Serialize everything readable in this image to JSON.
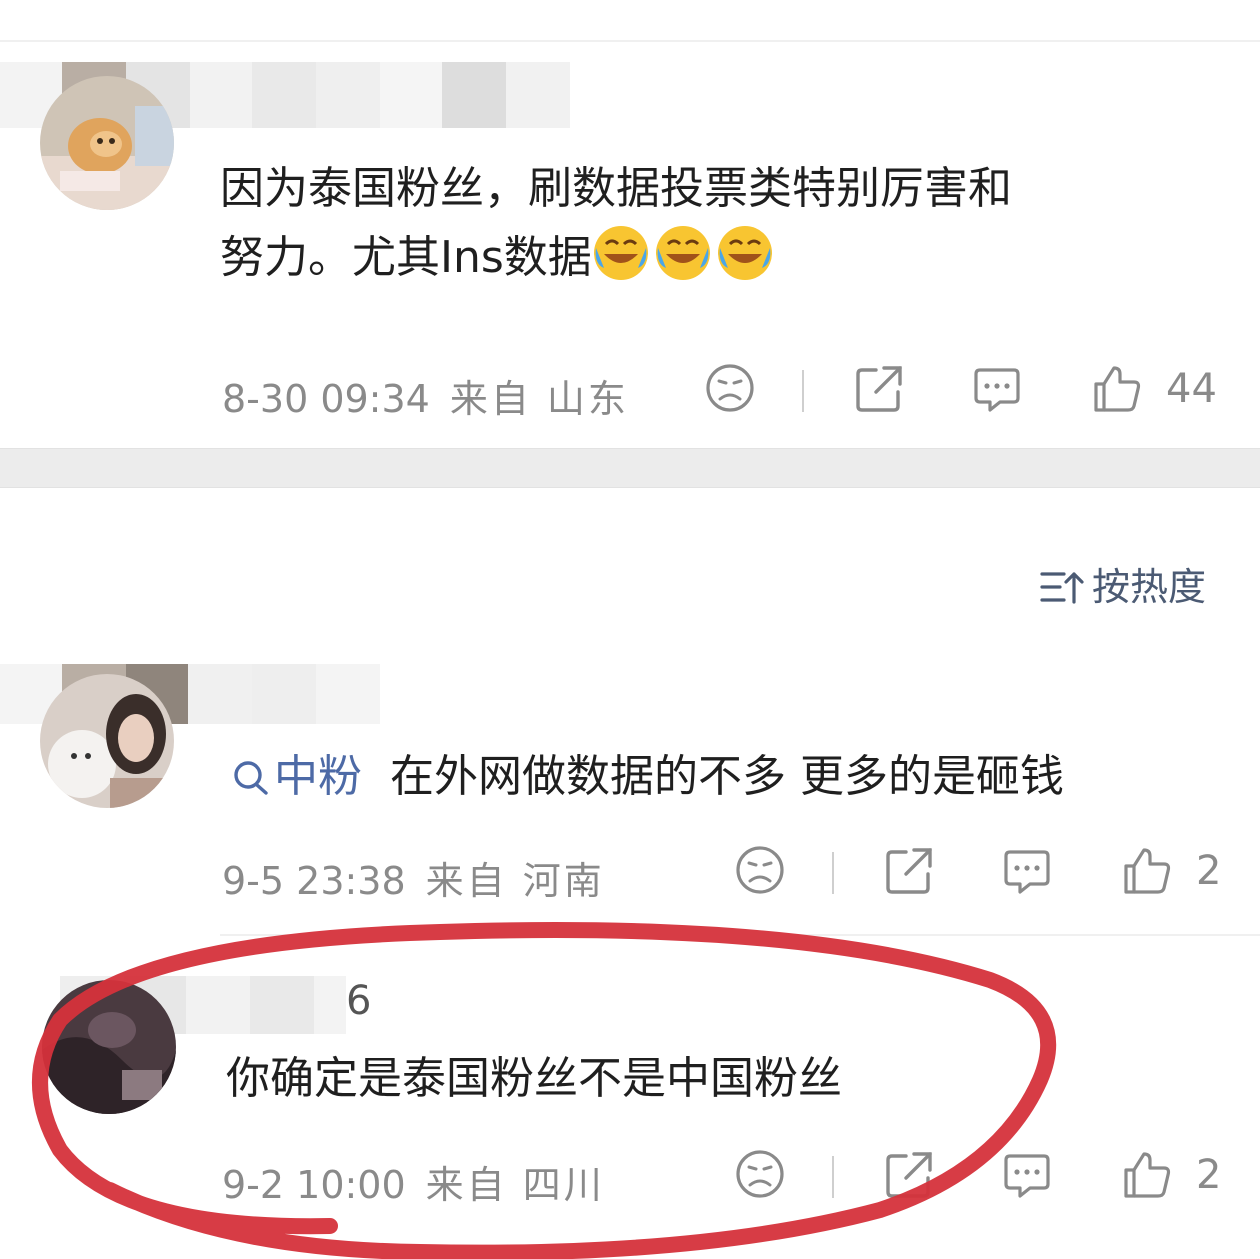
{
  "comments": [
    {
      "content_line1": "因为泰国粉丝，刷数据投票类特别厉害和",
      "content_line2": "努力。尤其Ins数据",
      "time": "8-30 09:34",
      "source": "来自 山东",
      "likes": "44"
    },
    {
      "fan_label": "中粉",
      "content": "在外网做数据的不多 更多的是砸钱",
      "time": "9-5 23:38",
      "source": "来自 河南",
      "likes": "2"
    },
    {
      "username_tail": "6",
      "content": "你确定是泰国粉丝不是中国粉丝",
      "time": "9-2 10:00",
      "source": "来自 四川",
      "likes": "2"
    }
  ],
  "sort": {
    "label": "按热度"
  },
  "icons": [
    "dislike-face-icon",
    "share-icon",
    "reply-icon",
    "like-thumb-icon",
    "laugh-cry-emoji-icon",
    "search-icon",
    "sort-icon"
  ],
  "colors": {
    "annotation_red": "#d5323b",
    "meta_gray": "#8a8a8a",
    "sort_blue": "#4b5a73",
    "fan_blue": "#4d6aa6"
  }
}
